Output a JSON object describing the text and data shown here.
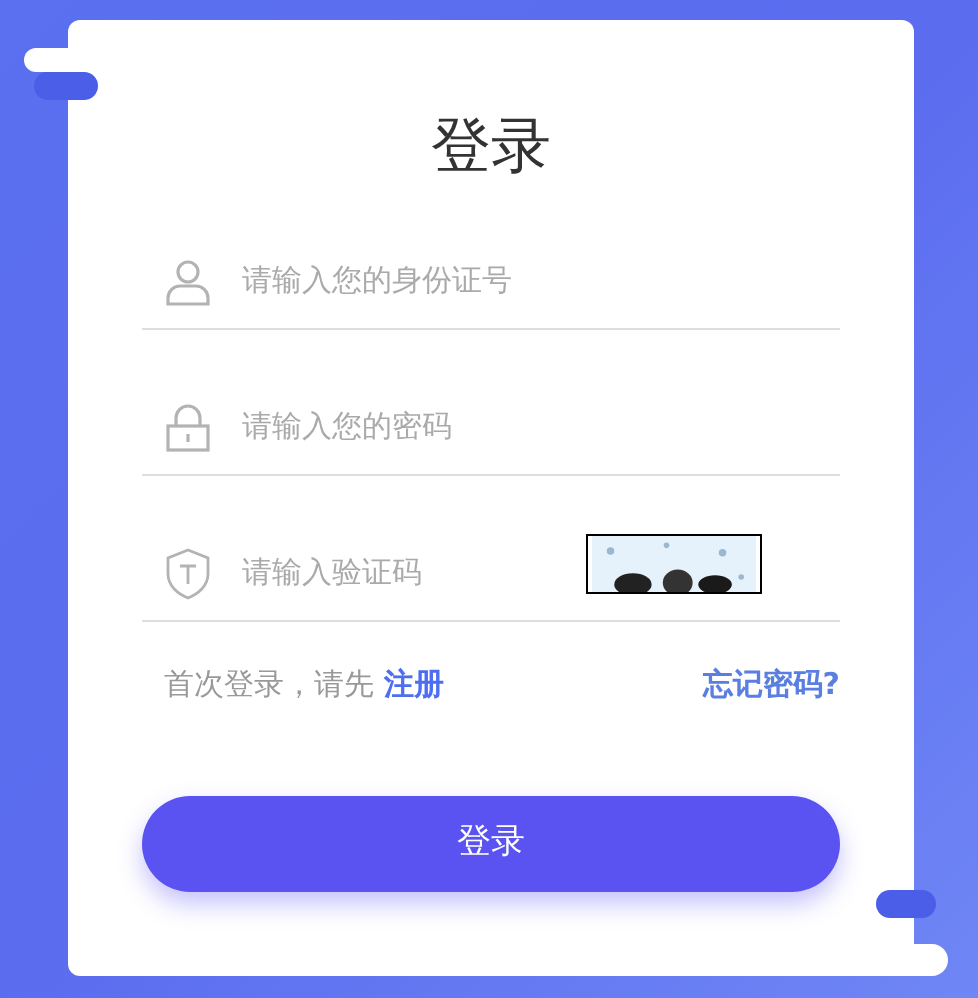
{
  "title": "登录",
  "fields": [
    {
      "kind": "user",
      "placeholder": "请输入您的身份证号"
    },
    {
      "kind": "password",
      "placeholder": "请输入您的密码"
    },
    {
      "kind": "captcha",
      "placeholder": "请输入验证码"
    }
  ],
  "register_prompt": {
    "text": "首次登录，请先",
    "link": "注册"
  },
  "forgot_password": "忘记密码?",
  "login_button": "登录"
}
